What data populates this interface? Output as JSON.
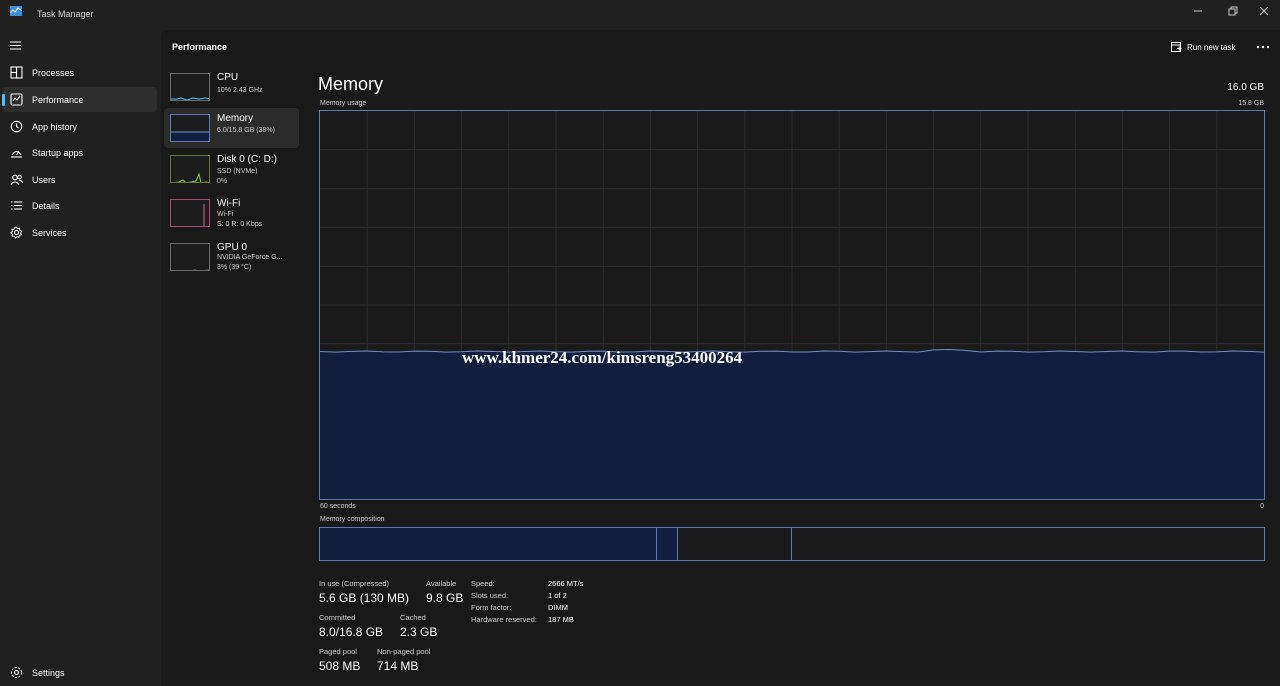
{
  "window": {
    "title": "Task Manager"
  },
  "nav": {
    "items": [
      {
        "label": "Processes"
      },
      {
        "label": "Performance"
      },
      {
        "label": "App history"
      },
      {
        "label": "Startup apps"
      },
      {
        "label": "Users"
      },
      {
        "label": "Details"
      },
      {
        "label": "Services"
      }
    ],
    "settings_label": "Settings"
  },
  "header": {
    "title": "Performance",
    "run_new_task": "Run new task"
  },
  "devices": [
    {
      "name": "CPU",
      "line1": "10% 2.43 GHz",
      "line2": ""
    },
    {
      "name": "Memory",
      "line1": "6.0/15.8 GB (38%)",
      "line2": ""
    },
    {
      "name": "Disk 0 (C: D:)",
      "line1": "SSD (NVMe)",
      "line2": "0%"
    },
    {
      "name": "Wi-Fi",
      "line1": "Wi-Fi",
      "line2": "S: 0 R: 0 Kbps"
    },
    {
      "name": "GPU 0",
      "line1": "NVIDIA GeForce G...",
      "line2": "3% (39 °C)"
    }
  ],
  "memory": {
    "title": "Memory",
    "total": "16.0 GB",
    "usage_label": "Memory usage",
    "usage_max": "15.8 GB",
    "time_left": "60 seconds",
    "time_right": "0",
    "composition_label": "Memory composition",
    "watermark": "www.khmer24.com/kimsreng53400264",
    "usage_fraction": 0.38,
    "stats": {
      "in_use_label": "In use (Compressed)",
      "in_use": "5.6 GB (130 MB)",
      "available_label": "Available",
      "available": "9.8 GB",
      "committed_label": "Committed",
      "committed": "8.0/16.8 GB",
      "cached_label": "Cached",
      "cached": "2.3 GB",
      "paged_label": "Paged pool",
      "paged": "508 MB",
      "nonpaged_label": "Non-paged pool",
      "nonpaged": "714 MB"
    },
    "specs": [
      {
        "key": "Speed:",
        "value": "2666 MT/s"
      },
      {
        "key": "Slots used:",
        "value": "1 of 2"
      },
      {
        "key": "Form factor:",
        "value": "DIMM"
      },
      {
        "key": "Hardware reserved:",
        "value": "187 MB"
      }
    ]
  },
  "colors": {
    "accent": "#4cc2ff",
    "memory_fill": "#0f1f3d",
    "memory_line": "#6f8fcf",
    "graph_border": "#5a7ab5"
  }
}
